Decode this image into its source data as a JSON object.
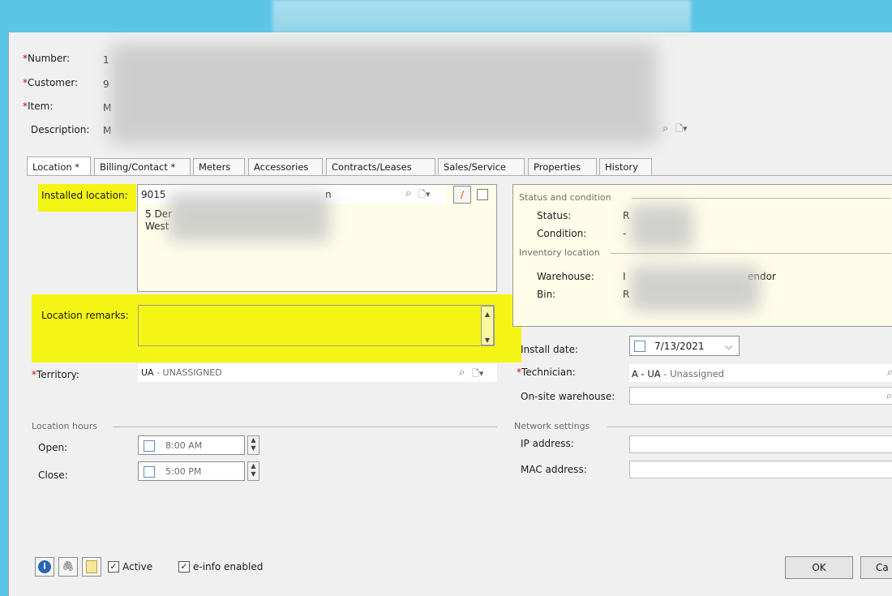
{
  "header": {
    "number_label": "Number:",
    "customer_label": "Customer:",
    "item_label": "Item:",
    "description_label": "Description:",
    "number_value_fragment": "1",
    "customer_value_fragment": "9",
    "item_value_fragment": "M",
    "description_value_fragment": "M"
  },
  "tabs": [
    {
      "label": "Location *"
    },
    {
      "label": "Billing/Contact *"
    },
    {
      "label": "Meters"
    },
    {
      "label": "Accessories"
    },
    {
      "label": "Contracts/Leases"
    },
    {
      "label": "Sales/Service"
    },
    {
      "label": "Properties"
    },
    {
      "label": "History"
    }
  ],
  "location": {
    "installed_label": "Installed location:",
    "installed_code": "9015",
    "installed_suffix": "n",
    "address_line1": "5 Der",
    "address_line2": "West",
    "remarks_label": "Location remarks:",
    "territory_label": "Territory:",
    "territory_code": "UA",
    "territory_name": " - UNASSIGNED"
  },
  "status": {
    "section_title": "Status and condition",
    "status_label": "Status:",
    "status_value_fragment": "R",
    "condition_label": "Condition:",
    "condition_value_fragment": "-",
    "inventory_title": "Inventory location",
    "warehouse_label": "Warehouse:",
    "warehouse_value_fragment": "I",
    "warehouse_suffix": "endor",
    "bin_label": "Bin:",
    "bin_value_fragment": "R"
  },
  "right_fields": {
    "install_date_label": "Install date:",
    "install_date_value": "7/13/2021",
    "technician_label": "Technician:",
    "technician_code": "A - UA",
    "technician_name": " - Unassigned",
    "onsite_label": "On-site warehouse:"
  },
  "hours": {
    "section_title": "Location hours",
    "open_label": "Open:",
    "open_value": "8:00 AM",
    "close_label": "Close:",
    "close_value": "5:00 PM"
  },
  "network": {
    "section_title": "Network settings",
    "ip_label": "IP address:",
    "mac_label": "MAC address:"
  },
  "footer": {
    "active_label": "Active",
    "einfo_label": "e-info enabled",
    "ok_label": "OK",
    "cancel_fragment": "Ca"
  },
  "colors": {
    "highlight": "#f5f515",
    "cream": "#fffde9",
    "required": "#cc0000",
    "titlebar": "#5bc5e6"
  }
}
